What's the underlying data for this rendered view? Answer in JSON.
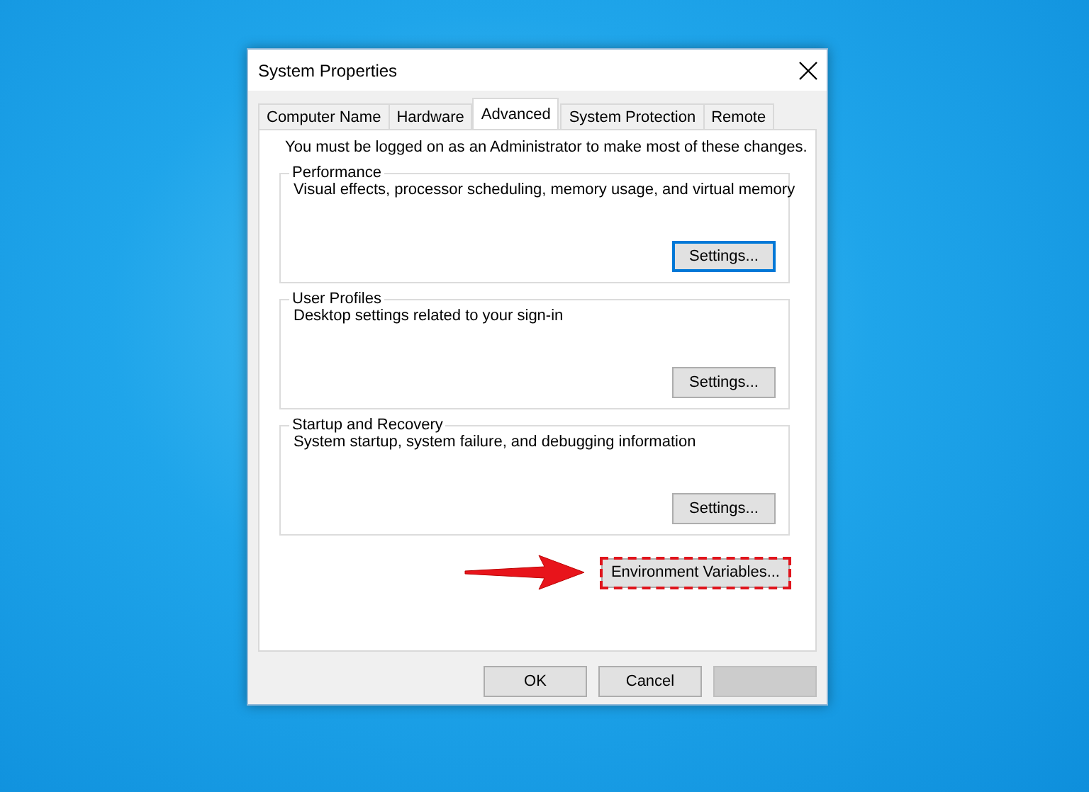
{
  "window": {
    "title": "System Properties"
  },
  "tabs": [
    {
      "label": "Computer Name",
      "selected": false
    },
    {
      "label": "Hardware",
      "selected": false
    },
    {
      "label": "Advanced",
      "selected": true
    },
    {
      "label": "System Protection",
      "selected": false
    },
    {
      "label": "Remote",
      "selected": false
    }
  ],
  "notice": "You must be logged on as an Administrator to make most of these changes.",
  "groups": [
    {
      "title": "Performance",
      "description": "Visual effects, processor scheduling, memory usage, and virtual memory",
      "button": {
        "label": "Settings...",
        "focused": true
      }
    },
    {
      "title": "User Profiles",
      "description": "Desktop settings related to your sign-in",
      "button": {
        "label": "Settings...",
        "focused": false
      }
    },
    {
      "title": "Startup and Recovery",
      "description": "System startup, system failure, and debugging information",
      "button": {
        "label": "Settings...",
        "focused": false
      }
    }
  ],
  "environment_button": {
    "label": "Environment Variables...",
    "highlighted": true
  },
  "buttons": [
    {
      "label": "OK",
      "disabled": false
    },
    {
      "label": "Cancel",
      "disabled": false
    },
    {
      "disabled": true
    }
  ]
}
